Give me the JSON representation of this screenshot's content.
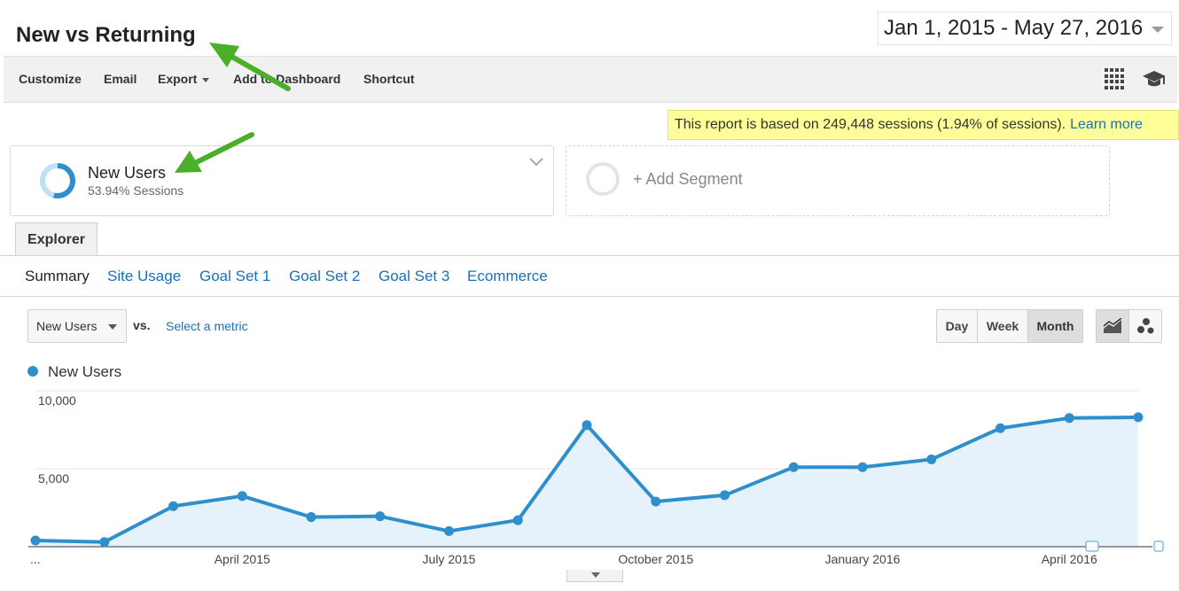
{
  "report": {
    "title": "New vs Returning"
  },
  "date_range": {
    "label": "Jan 1, 2015 - May 27, 2016"
  },
  "toolbar": {
    "customize": "Customize",
    "email": "Email",
    "export": "Export",
    "add_to_dashboard": "Add to Dashboard",
    "shortcut": "Shortcut",
    "icons": [
      "grid-icon",
      "graduation-cap-icon"
    ]
  },
  "notice": {
    "text": "This report is based on 249,448 sessions (1.94% of sessions).",
    "link": "Learn more",
    "color": "#ffff99"
  },
  "segment": {
    "name": "New Users",
    "subtitle": "53.94% Sessions",
    "share": 0.5394,
    "add_label": "+ Add Segment"
  },
  "explorer_tab": "Explorer",
  "subnav": [
    "Summary",
    "Site Usage",
    "Goal Set 1",
    "Goal Set 2",
    "Goal Set 3",
    "Ecommerce"
  ],
  "metric": {
    "selected": "New Users",
    "vs": "vs.",
    "select_metric": "Select a metric"
  },
  "period": {
    "options": [
      "Day",
      "Week",
      "Month"
    ],
    "selected": "Month"
  },
  "view_icons": [
    "line-chart-icon",
    "motion-chart-icon"
  ],
  "legend": {
    "label": "New Users",
    "color": "#2f8fcc"
  },
  "chart_data": {
    "type": "area",
    "series": [
      {
        "name": "New Users",
        "values": [
          400,
          300,
          2600,
          3250,
          1900,
          1950,
          1000,
          1700,
          7800,
          2900,
          3300,
          5100,
          5100,
          5600,
          7600,
          8250,
          8300
        ]
      }
    ],
    "x_tick_labels": [
      "...",
      "April 2015",
      "July 2015",
      "October 2015",
      "January 2016",
      "April 2016"
    ],
    "y_tick_labels": [
      "10,000",
      "5,000"
    ],
    "ylim": [
      0,
      10000
    ],
    "grid": true,
    "line_color": "#2f8fcc",
    "fill_color": "#e6f2fb"
  }
}
